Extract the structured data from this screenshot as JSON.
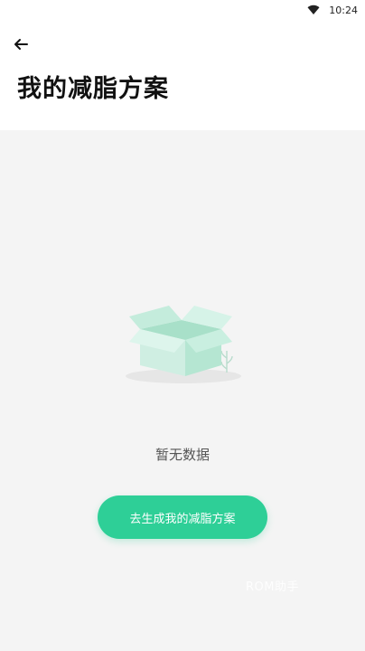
{
  "status_bar": {
    "time": "10:24",
    "wifi_icon": "wifi-icon"
  },
  "header": {
    "back_icon": "back-arrow-icon",
    "title": "我的减脂方案"
  },
  "empty_state": {
    "illustration_icon": "empty-box-icon",
    "message": "暂无数据",
    "accent_color": "#2ecf97"
  },
  "actions": {
    "generate_label": "去生成我的减脂方案"
  },
  "watermark": {
    "text": "ROM助手"
  }
}
